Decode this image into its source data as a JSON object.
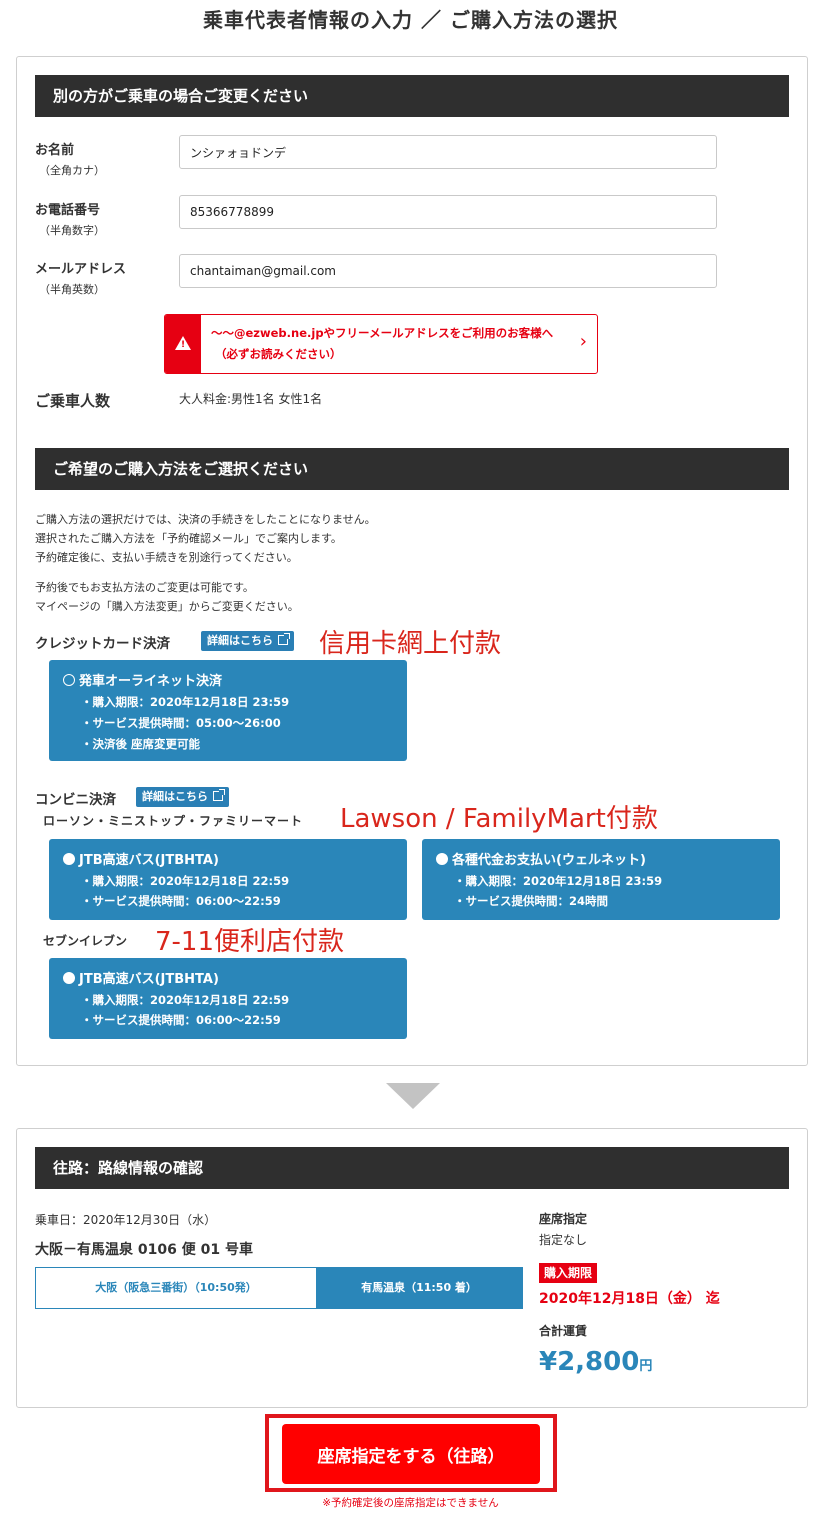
{
  "page_title": "乗車代表者情報の入力 ／ ご購入方法の選択",
  "passenger_section": {
    "header": "別の方がご乗車の場合ご変更ください",
    "name": {
      "label": "お名前",
      "sub": "（全角カナ）",
      "value": "ンシァォョドンデ"
    },
    "phone": {
      "label": "お電話番号",
      "sub": "（半角数字）",
      "value": "85366778899"
    },
    "email": {
      "label": "メールアドレス",
      "sub": "（半角英数）",
      "value": "chantaiman@gmail.com"
    },
    "warning": {
      "line1": "〜〜@ezweb.ne.jpやフリーメールアドレスをご利用のお客様へ",
      "line2": "（必ずお読みください）"
    },
    "passengers": {
      "label": "ご乗車人数",
      "value": "大人料金:男性1名  女性1名"
    }
  },
  "purchase_section": {
    "header": "ご希望のご購入方法をご選択ください",
    "notes1": [
      "ご購入方法の選択だけでは、決済の手続きをしたことになりません。",
      "選択されたご購入方法を「予約確認メール」でご案内します。",
      "予約確定後に、支払い手続きを別途行ってください。"
    ],
    "notes2": [
      "予約後でもお支払方法のご変更は可能です。",
      "マイページの「購入方法変更」からご変更ください。"
    ],
    "credit": {
      "label": "クレジットカード決済",
      "detail_label": "詳細はこちら",
      "annotation": "信用卡網上付款",
      "option": {
        "title": "発車オーライネット決済",
        "lines": [
          "・購入期限：2020年12月18日 23:59",
          "・サービス提供時間：05:00〜26:00",
          "・決済後 座席変更可能"
        ]
      }
    },
    "convenience": {
      "label": "コンビニ決済",
      "detail_label": "詳細はこちら",
      "stores_label": "ローソン・ミニストップ・ファミリーマート",
      "stores_annotation": "Lawson / FamilyMart付款",
      "option_a": {
        "title": "JTB高速バス(JTBHTA)",
        "lines": [
          "・購入期限：2020年12月18日 22:59",
          "・サービス提供時間：06:00〜22:59"
        ]
      },
      "option_b": {
        "title": "各種代金お支払い(ウェルネット)",
        "lines": [
          "・購入期限：2020年12月18日 23:59",
          "・サービス提供時間：24時間"
        ]
      },
      "seven_label": "セブンイレブン",
      "seven_annotation": "7-11便利店付款",
      "option_c": {
        "title": "JTB高速バス(JTBHTA)",
        "lines": [
          "・購入期限：2020年12月18日 22:59",
          "・サービス提供時間：06:00〜22:59"
        ]
      }
    }
  },
  "route_section": {
    "header": "往路：路線情報の確認",
    "date": "乗車日：2020年12月30日（水）",
    "route": "大阪－有馬温泉 0106 便 01 号車",
    "from": "大阪（阪急三番街）（10:50発）",
    "to": "有馬温泉（11:50 着）",
    "seat_label": "座席指定",
    "seat_value": "指定なし",
    "deadline_badge": "購入期限",
    "deadline_date": "2020年12月18日（金） 迄",
    "fare_label": "合計運賃",
    "fare_value": "¥2,800",
    "fare_unit": "円"
  },
  "cta": {
    "label": "座席指定をする（往路）",
    "note": "※予約確定後の座席指定はできません"
  },
  "colors": {
    "accent_blue": "#2a86b9",
    "alert_red": "#e60012",
    "dark_bar": "#2f2f2f"
  }
}
